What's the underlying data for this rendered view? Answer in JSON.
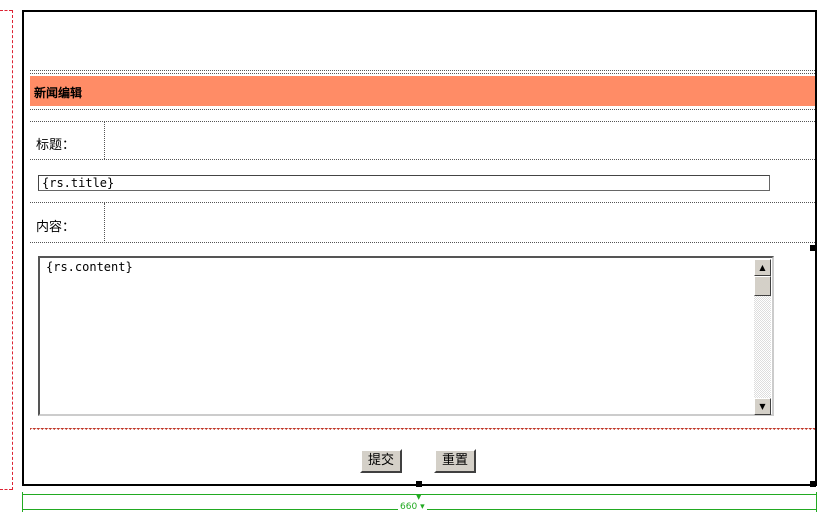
{
  "form": {
    "header_title": "新闻编辑",
    "title_label": "标题：",
    "title_value": "{rs.title}",
    "content_label": "内容：",
    "content_value": "{rs.content}",
    "submit_label": "提交",
    "reset_label": "重置"
  },
  "ruler": {
    "width_label": "660"
  },
  "colors": {
    "header_bg": "#ff8c66",
    "guide": "#dd2233",
    "ruler": "#22aa22"
  },
  "icons": {
    "scroll_up": "triangle-up",
    "scroll_down": "triangle-down"
  }
}
